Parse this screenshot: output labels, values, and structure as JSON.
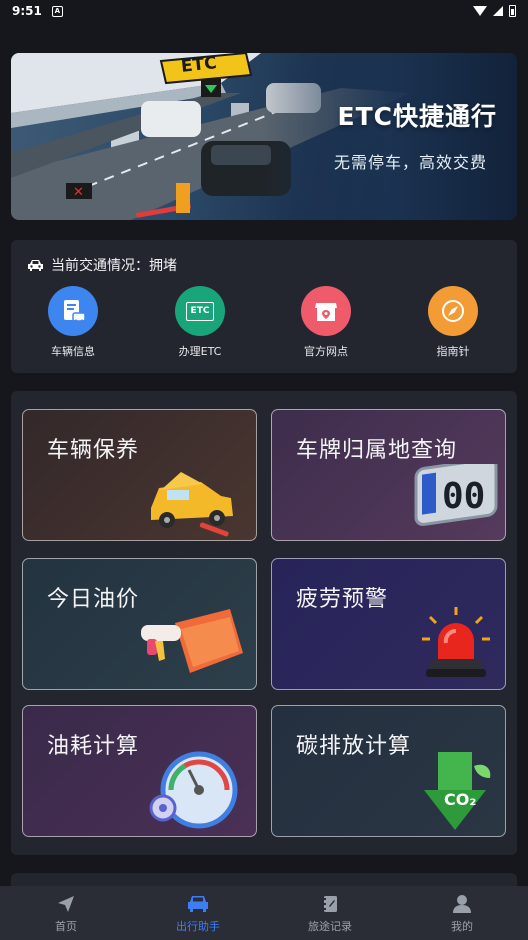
{
  "status_bar": {
    "time": "9:51",
    "notification_glyph": "A"
  },
  "banner": {
    "sign_text": "ETC",
    "title": "ETC快捷通行",
    "subtitle": "无需停车，高效交费"
  },
  "traffic": {
    "label": "当前交通情况：",
    "value": "拥堵"
  },
  "quick_actions": [
    {
      "label": "车辆信息",
      "icon": "vehicle-info-icon",
      "color": "#3d86f0"
    },
    {
      "label": "办理ETC",
      "icon": "etc-icon",
      "color": "#18a57a",
      "icon_text": "ETC"
    },
    {
      "label": "官方网点",
      "icon": "store-location-icon",
      "color": "#ef5b6b"
    },
    {
      "label": "指南针",
      "icon": "compass-icon",
      "color": "#f39b35"
    }
  ],
  "tiles": [
    {
      "label": "车辆保养",
      "icon": "car-repair-icon"
    },
    {
      "label": "车牌归属地查询",
      "icon": "license-plate-icon",
      "plate_text": "00"
    },
    {
      "label": "今日油价",
      "icon": "fuel-nozzle-icon"
    },
    {
      "label": "疲劳预警",
      "icon": "alarm-light-icon"
    },
    {
      "label": "油耗计算",
      "icon": "fuel-gauge-icon"
    },
    {
      "label": "碳排放计算",
      "icon": "co2-arrow-icon",
      "co2_text": "CO₂"
    }
  ],
  "bottom_nav": [
    {
      "label": "首页",
      "icon": "paper-plane-icon",
      "active": false
    },
    {
      "label": "出行助手",
      "icon": "car-front-icon",
      "active": true
    },
    {
      "label": "旅途记录",
      "icon": "notebook-icon",
      "active": false
    },
    {
      "label": "我的",
      "icon": "user-icon",
      "active": false
    }
  ],
  "colors": {
    "background": "#15171d",
    "card": "#23262e",
    "accent": "#3d7ef5",
    "nav_inactive": "#9aa0aa"
  }
}
